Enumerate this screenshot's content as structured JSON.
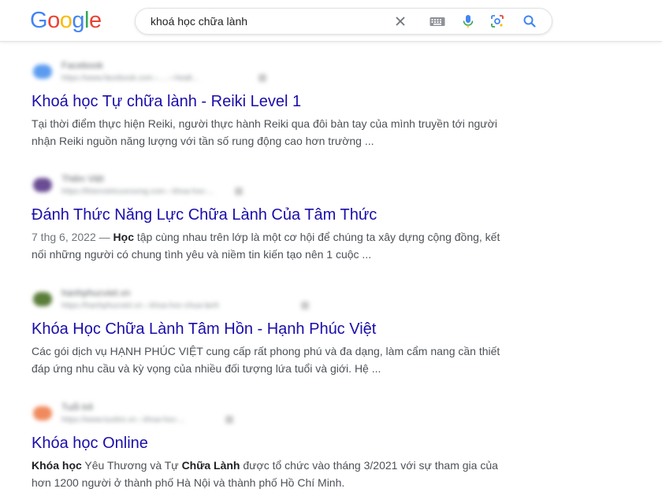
{
  "logo": {
    "text": "Google",
    "letters": [
      "G",
      "o",
      "o",
      "g",
      "l",
      "e"
    ],
    "colors": [
      "#4285F4",
      "#EA4335",
      "#FBBC05",
      "#4285F4",
      "#34A853",
      "#EA4335"
    ]
  },
  "search": {
    "query": "khoá học chữa lành",
    "icons": [
      "clear-icon",
      "keyboard-icon",
      "microphone-icon",
      "lens-icon",
      "search-icon"
    ]
  },
  "results": [
    {
      "source_name": "Facebook",
      "source_url": "https://www.facebook.com › ... › Healt...",
      "favicon_color": "#5b9bf0",
      "title": "Khoá học Tự chữa lành - Reiki Level 1",
      "snippet_line1": "Tại thời điểm thực hiện Reiki, người thực hành Reiki qua đôi bàn tay của mình truyền tới người",
      "snippet_line2": "nhận Reiki nguồn năng lượng với tần số rung động cao hơn trường ..."
    },
    {
      "source_name": "Thiền Việt",
      "source_url": "https://thienvietcuocsong.com › khoa-hoc-...",
      "favicon_color": "#6a4c93",
      "title": "Đánh Thức Năng Lực Chữa Lành Của Tâm Thức",
      "date": "7 thg 6, 2022",
      "separator": "—",
      "bold_word": "Học",
      "snippet_line1_rest": " tập cùng nhau trên lớp là một cơ hội để chúng ta xây dựng cộng đồng, kết",
      "snippet_line2": "nối những người có chung tình yêu và niềm tin kiến tạo nên 1 cuộc ..."
    },
    {
      "source_name": "hanhphucviet.vn",
      "source_url": "https://hanhphucviet.vn › khoa-hoc-chua-lanh",
      "favicon_color": "#5a7d3a",
      "title": "Khóa Học Chữa Lành Tâm Hồn - Hạnh Phúc Việt",
      "snippet_line1": "Các gói dịch vụ HẠNH PHÚC VIỆT cung cấp rất phong phú và đa dạng, làm cẩm nang cần thiết",
      "snippet_line2": "đáp ứng nhu cầu và kỳ vọng của nhiều đối tượng lứa tuổi và giới. Hệ ..."
    },
    {
      "source_name": "Tuổi trẻ",
      "source_url": "https://www.tuoitre.vn › khoa-hoc-...",
      "favicon_color": "#f08a5d",
      "title": "Khóa học Online",
      "bold1": "Khóa học",
      "text1": " Yêu Thương và Tự ",
      "bold2": "Chữa Lành",
      "text2": " được tổ chức vào tháng 3/2021 với sự tham gia của",
      "snippet_line2": "hơn 1200 người ở thành phố Hà Nội và thành phố Hồ Chí Minh."
    }
  ]
}
